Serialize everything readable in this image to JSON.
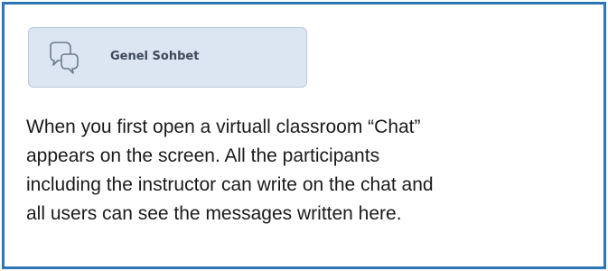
{
  "chat_tab": {
    "label": "Genel Sohbet",
    "icon": "chat-bubbles-icon",
    "background_color": "#DCE6F2",
    "icon_color": "#5a6b7d"
  },
  "description": {
    "lines": [
      "When you first open a virtuall classroom “Chat”",
      "appears on the screen. All the participants",
      "including the instructor can write on the chat and",
      "all users can see the messages written here."
    ]
  },
  "colors": {
    "frame_border": "#2E75B6",
    "text": "#1a1a1a"
  }
}
